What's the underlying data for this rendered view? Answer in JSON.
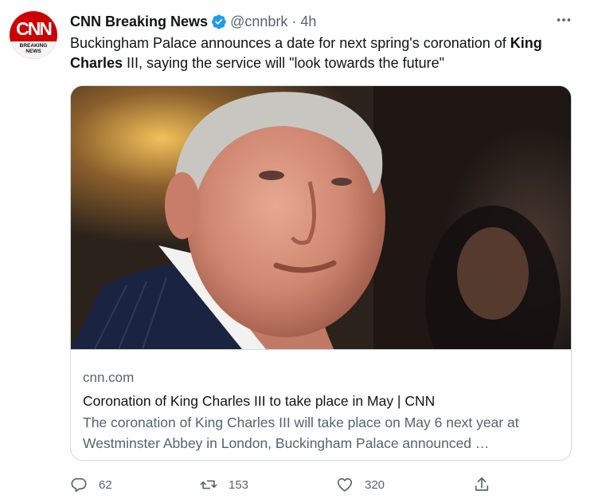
{
  "tweet": {
    "author_name": "CNN Breaking News",
    "handle": "@cnnbrk",
    "separator": "·",
    "time": "4h",
    "more_icon": "more-horizontal-icon",
    "text_parts": {
      "a": "Buckingham Palace announces a date for next spring's coronation of ",
      "b": "King Charles",
      "c": " III, saying the service will \"look towards the future\""
    }
  },
  "avatar": {
    "logo_text": "CNN",
    "line1": "BREAKING",
    "line2": "NEWS"
  },
  "card": {
    "domain": "cnn.com",
    "title": "Coronation of King Charles III to take place in May | CNN",
    "description": "The coronation of King Charles III will take place on May 6 next year at Westminster Abbey in London, Buckingham Palace announced …"
  },
  "actions": {
    "replies": "62",
    "retweets": "153",
    "likes": "320"
  },
  "colors": {
    "brand_red": "#cc0000",
    "verified_blue": "#1d9bf0",
    "muted_text": "#536471"
  }
}
